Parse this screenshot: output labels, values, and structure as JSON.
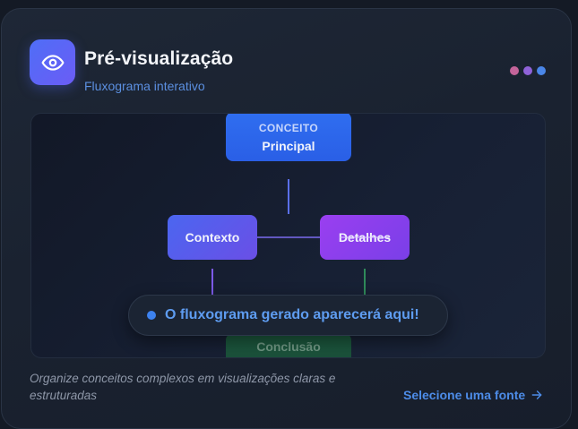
{
  "header": {
    "icon": "eye-icon",
    "title": "Pré-visualização",
    "subtitle": "Fluxograma interativo"
  },
  "window_dots": [
    {
      "color": "#c4649a"
    },
    {
      "color": "#8f62d8"
    },
    {
      "color": "#4a86e8"
    }
  ],
  "flowchart": {
    "main_node": {
      "tag": "CONCEITO",
      "label": "Principal"
    },
    "context_node": {
      "label": "Contexto"
    },
    "details_node": {
      "label": "Detalhes"
    },
    "conclusion_node": {
      "label": "Conclusão"
    }
  },
  "placeholder": {
    "text": "O fluxograma gerado aparecerá aqui!"
  },
  "footer": {
    "description": "Organize conceitos complexos em visualizações claras e estruturadas",
    "link_label": "Selecione uma fonte",
    "link_icon": "arrow-right-icon"
  }
}
